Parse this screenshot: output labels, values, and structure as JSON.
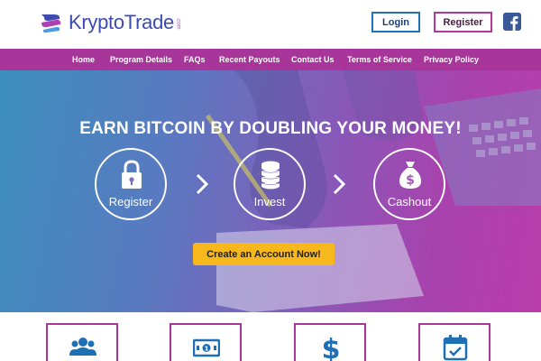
{
  "header": {
    "logo_text": "KryptoTrade",
    "logo_sub": ".com",
    "login_label": "Login",
    "register_label": "Register"
  },
  "nav": {
    "items": [
      {
        "label": "Home"
      },
      {
        "label": "Program Details"
      },
      {
        "label": "FAQs"
      },
      {
        "label": "Recent Payouts"
      },
      {
        "label": "Contact Us"
      },
      {
        "label": "Terms of Service"
      },
      {
        "label": "Privacy Policy"
      }
    ]
  },
  "hero": {
    "title": "EARN BITCOIN BY DOUBLING YOUR MONEY!",
    "steps": [
      {
        "label": "Register",
        "icon": "lock-icon"
      },
      {
        "label": "Invest",
        "icon": "coins-icon"
      },
      {
        "label": "Cashout",
        "icon": "money-bag-icon"
      }
    ],
    "cta_label": "Create an Account Now!"
  },
  "features": [
    {
      "icon": "users-icon"
    },
    {
      "icon": "cash-icon"
    },
    {
      "icon": "dollar-icon"
    },
    {
      "icon": "calendar-check-icon"
    }
  ],
  "colors": {
    "brand_purple": "#a8359a",
    "brand_blue": "#3d4bb0",
    "cta_yellow": "#f6b81d",
    "facebook": "#3b5998"
  }
}
